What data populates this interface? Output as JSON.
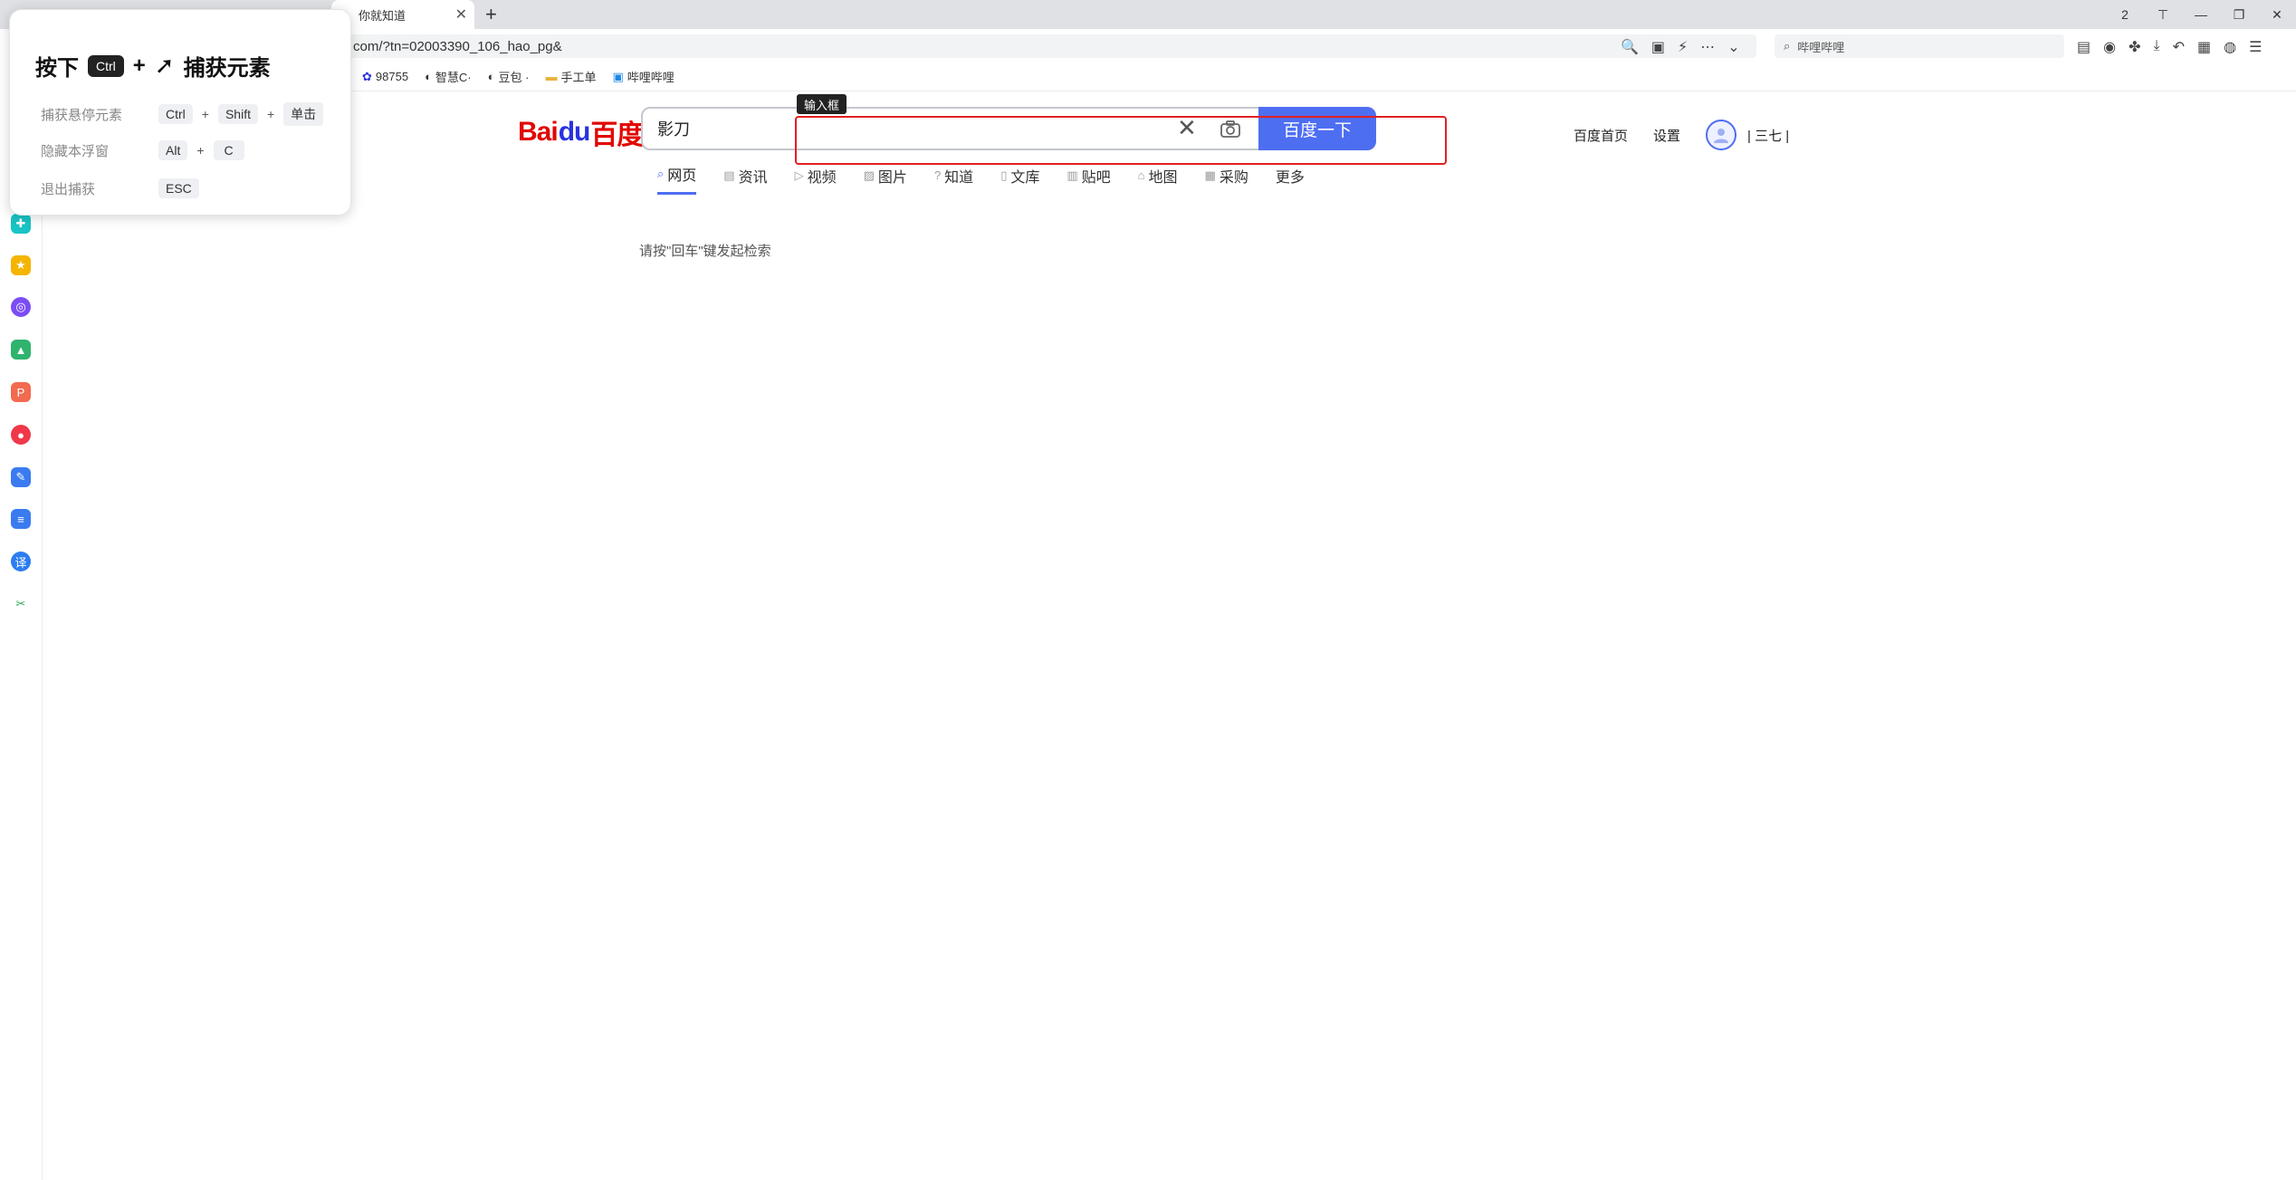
{
  "browser": {
    "tab_title": "你就知道",
    "new_tab_label": "+",
    "url": "com/?tn=02003390_106_hao_pg&",
    "search_text": "哔哩哔哩",
    "window_controls": [
      "2",
      "⊤",
      "—",
      "❐",
      "✕"
    ],
    "bookmarks": [
      {
        "label": "98755",
        "icon": "baidu-paw-icon"
      },
      {
        "label": "智慧C·",
        "icon": "globe-icon"
      },
      {
        "label": "豆包 ·",
        "icon": "globe-icon"
      },
      {
        "label": "手工单",
        "icon": "folder-icon"
      },
      {
        "label": "哔哩哔哩",
        "icon": "bilibili-icon"
      }
    ]
  },
  "capture_panel": {
    "title_prefix": "按下",
    "title_key": "Ctrl",
    "title_plus": "+",
    "title_suffix": "捕获元素",
    "rows": [
      {
        "label": "捕获悬停元素",
        "keys": [
          "Ctrl",
          "Shift",
          "单击"
        ]
      },
      {
        "label": "隐藏本浮窗",
        "keys": [
          "Alt",
          "C"
        ]
      },
      {
        "label": "退出捕获",
        "keys": [
          "ESC"
        ]
      }
    ]
  },
  "baidu": {
    "logo_left": "Bai",
    "logo_paw": "du",
    "logo_right": "百度",
    "search_value": "影刀",
    "search_button": "百度一下",
    "tooltip": "输入框",
    "nav": [
      {
        "label": "网页",
        "active": true
      },
      {
        "label": "资讯"
      },
      {
        "label": "视频"
      },
      {
        "label": "图片"
      },
      {
        "label": "知道"
      },
      {
        "label": "文库"
      },
      {
        "label": "贴吧"
      },
      {
        "label": "地图"
      },
      {
        "label": "采购"
      },
      {
        "label": "更多"
      }
    ],
    "hint": "请按\"回车\"键发起检索",
    "top_links": {
      "home": "百度首页",
      "settings": "设置",
      "username": "| 三七 |"
    }
  },
  "colors": {
    "accent": "#4e6ef2",
    "baidu_red": "#e10601",
    "baidu_blue": "#2932e1",
    "highlight": "#e02020"
  }
}
